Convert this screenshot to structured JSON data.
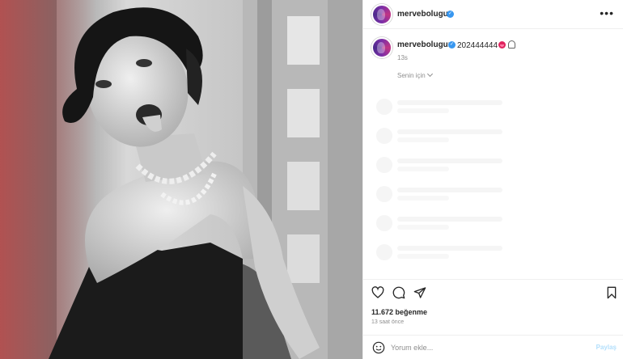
{
  "post": {
    "username": "mervebolugur",
    "verified": true
  },
  "caption": {
    "username": "mervebolugur",
    "text": "202444444",
    "time": "13s"
  },
  "translation": {
    "label": "Senin için"
  },
  "engagement": {
    "likes": "11.672 beğenme",
    "time_ago": "13 saat önce"
  },
  "comment": {
    "placeholder": "Yorum ekle...",
    "post_label": "Paylaş"
  },
  "icons": {
    "more": "more-options-icon",
    "like": "heart-icon",
    "comment": "comment-icon",
    "share": "send-icon",
    "save": "bookmark-icon",
    "emoji": "smiley-icon"
  },
  "colors": {
    "verified": "#3897f0",
    "secondary_text": "#8e8e8e",
    "post_button_disabled": "#b2dffc"
  }
}
